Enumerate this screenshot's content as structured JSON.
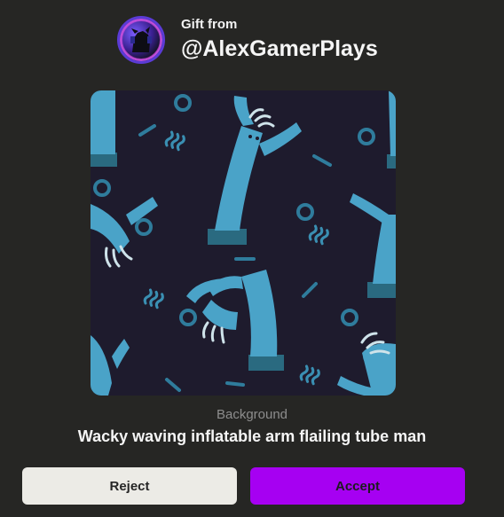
{
  "gift": {
    "label": "Gift from",
    "sender": "@AlexGamerPlays",
    "avatar_icon": "gamer-avatar-icon"
  },
  "item": {
    "type": "Background",
    "name": "Wacky waving inflatable arm flailing tube man",
    "image_icon": "wacky-tube-man-pattern"
  },
  "actions": {
    "reject_label": "Reject",
    "accept_label": "Accept"
  },
  "colors": {
    "page_bg": "#262624",
    "preview_bg": "#1e1b2d",
    "tube_blue": "#4aa3c8",
    "accept": "#a600f2",
    "reject": "#ecebe6"
  }
}
